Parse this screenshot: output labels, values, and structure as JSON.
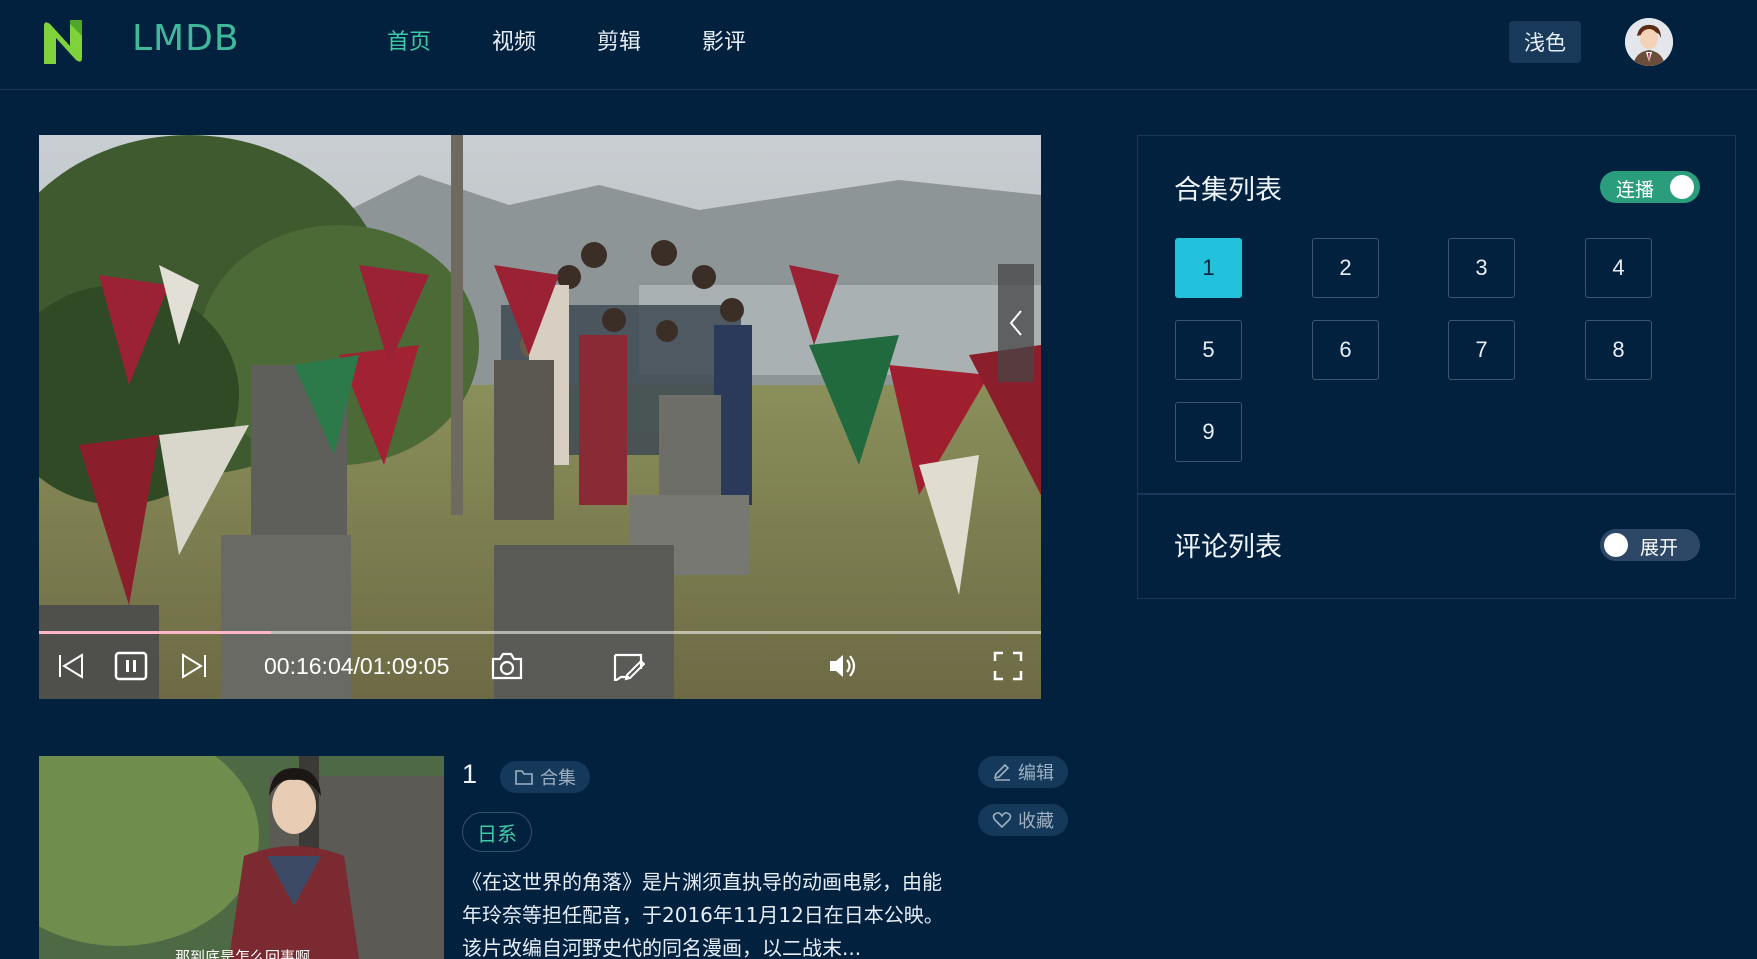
{
  "header": {
    "brand": "LMDB",
    "nav": [
      {
        "label": "首页",
        "active": true
      },
      {
        "label": "视频",
        "active": false
      },
      {
        "label": "剪辑",
        "active": false
      },
      {
        "label": "影评",
        "active": false
      }
    ],
    "theme_button": "浅色",
    "logo_icon": "n-logo-icon",
    "avatar_icon": "user-avatar"
  },
  "player": {
    "time": "00:16:04/01:09:05",
    "progress": 0.232,
    "icons": [
      "skip-previous-icon",
      "pause-icon",
      "skip-next-icon",
      "camera-icon",
      "edit-bubble-icon",
      "volume-icon",
      "fullscreen-icon",
      "chevron-left-icon"
    ],
    "accent_progress": "#ffb6c8"
  },
  "playlist": {
    "title": "合集列表",
    "autoplay_label": "连播",
    "autoplay_on": true,
    "episodes": [
      "1",
      "2",
      "3",
      "4",
      "5",
      "6",
      "7",
      "8",
      "9"
    ],
    "selected": "1"
  },
  "comments": {
    "title": "评论列表",
    "expand_label": "展开",
    "expanded": false
  },
  "info": {
    "episode_number": "1",
    "collection_label": "合集",
    "edit_label": "编辑",
    "favorite_label": "收藏",
    "tag": "日系",
    "description": "《在这世界的角落》是片渊须直执导的动画电影，由能年玲奈等担任配音，于2016年11月12日在日本公映。该片改编自河野史代的同名漫画，以二战末...",
    "thumb_subtitle": "那到底是怎么回事啊"
  },
  "colors": {
    "background": "#02213f",
    "accent_green": "#3fc9a4",
    "accent_cyan": "#22c1dc",
    "toggle_on": "#2a9d7c"
  }
}
